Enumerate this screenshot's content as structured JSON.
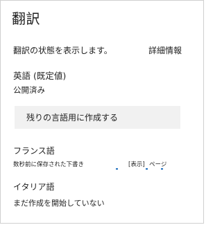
{
  "panel": {
    "title": "翻訳",
    "status_text": "翻訳の状態を表示します。",
    "details_link": "詳細情報"
  },
  "english": {
    "heading": "英語 (既定値)",
    "status": "公開済み"
  },
  "create_button": {
    "label": "残りの言語用に作成する"
  },
  "french": {
    "heading": "フランス語",
    "draft_text": "数秒前に保存された下書き",
    "show_label": "[表示]",
    "page_label": "ページ"
  },
  "italian": {
    "heading": "イタリア語",
    "status": "まだ作成を開始していない"
  },
  "colors": {
    "link_accent": "#1f6fbf",
    "button_bg": "#f1f1f1",
    "border": "#cfcfcf"
  }
}
